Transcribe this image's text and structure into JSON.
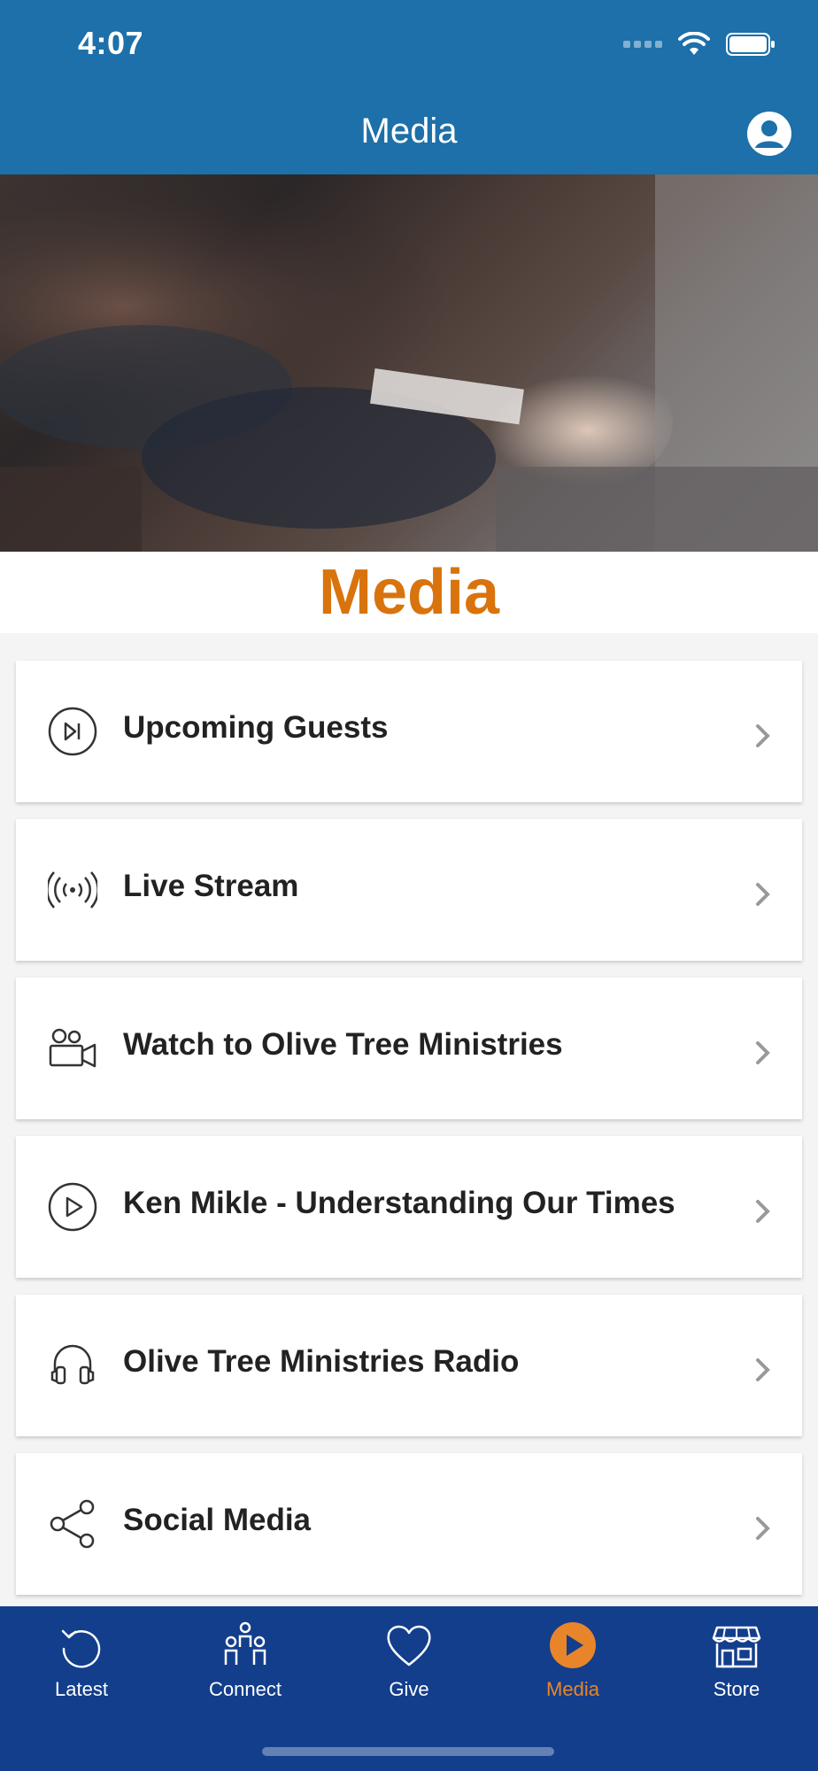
{
  "status_bar": {
    "time": "4:07"
  },
  "header": {
    "title": "Media"
  },
  "hero": {
    "title": "Media"
  },
  "menu": [
    {
      "label": "Upcoming Guests",
      "icon": "skip-forward-circle-icon"
    },
    {
      "label": "Live Stream",
      "icon": "broadcast-icon"
    },
    {
      "label": "Watch to Olive Tree Ministries",
      "icon": "video-camera-icon"
    },
    {
      "label": "Ken Mikle - Understanding Our Times",
      "icon": "play-circle-icon"
    },
    {
      "label": "Olive Tree Ministries Radio",
      "icon": "headphones-icon"
    },
    {
      "label": "Social Media",
      "icon": "share-icon"
    }
  ],
  "tabs": [
    {
      "label": "Latest",
      "icon": "refresh-icon",
      "active": false
    },
    {
      "label": "Connect",
      "icon": "people-icon",
      "active": false
    },
    {
      "label": "Give",
      "icon": "heart-icon",
      "active": false
    },
    {
      "label": "Media",
      "icon": "play-circle-icon",
      "active": true
    },
    {
      "label": "Store",
      "icon": "store-icon",
      "active": false
    }
  ],
  "colors": {
    "header_blue": "#1d70a9",
    "tabbar_blue": "#123e8c",
    "accent_orange": "#d9730d",
    "active_tab": "#e8852a"
  }
}
